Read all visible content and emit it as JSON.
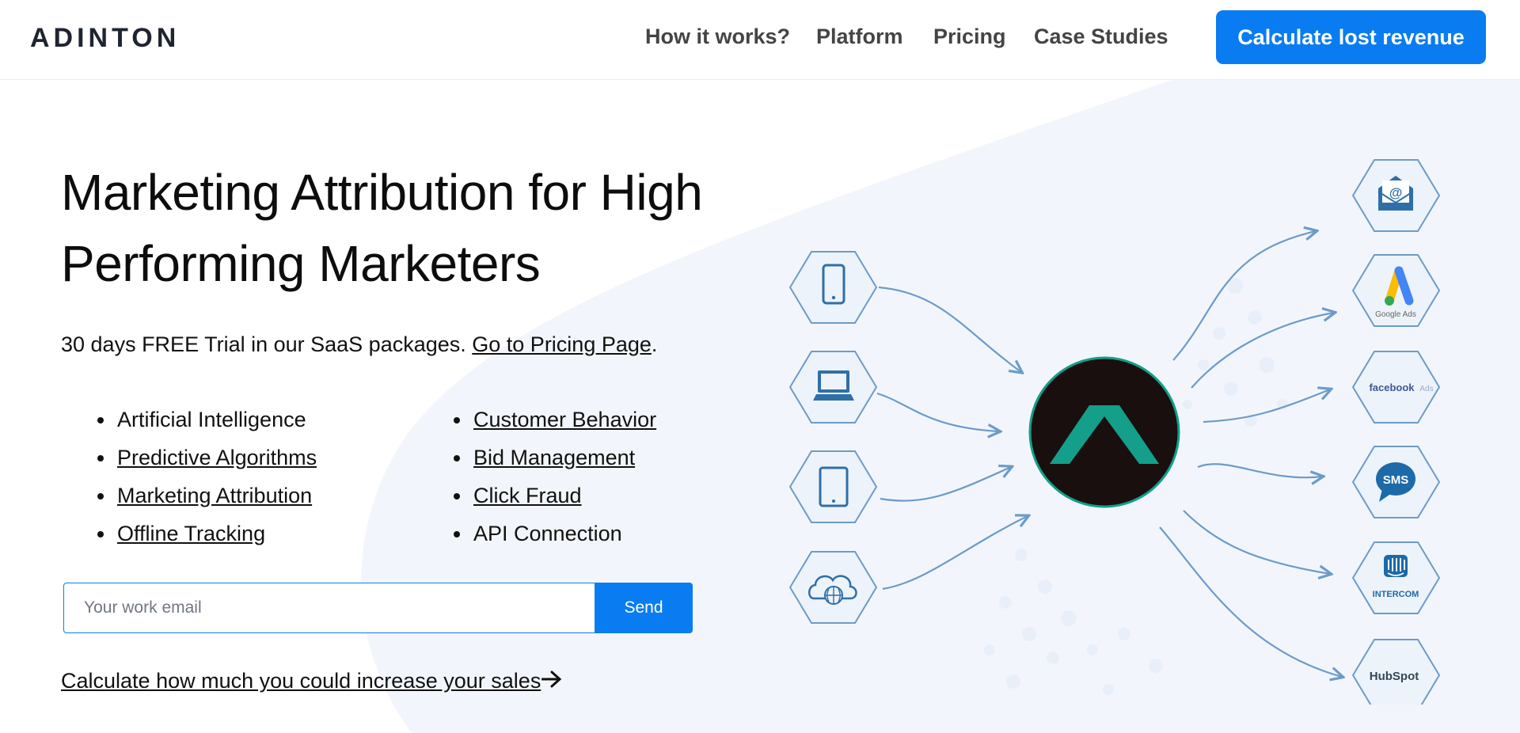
{
  "header": {
    "logo_text": "ADINTON",
    "nav": [
      {
        "label": "How it works?"
      },
      {
        "label": "Platform"
      },
      {
        "label": "Pricing"
      },
      {
        "label": "Case Studies"
      }
    ],
    "cta_label": "Calculate lost revenue"
  },
  "hero": {
    "title_line1": "Marketing Attribution for High",
    "title_line2": "Performing Marketers",
    "trial_text": "30 days FREE Trial in our SaaS packages. ",
    "trial_link": "Go to Pricing Page",
    "trial_suffix": ".",
    "features_left": [
      {
        "label": "Artificial Intelligence"
      },
      {
        "label": "Predictive Algorithms"
      },
      {
        "label": "Marketing Attribution"
      },
      {
        "label": "Offline Tracking"
      }
    ],
    "features_right": [
      {
        "label": "Customer Behavior"
      },
      {
        "label": "Bid Management"
      },
      {
        "label": "Click Fraud"
      },
      {
        "label": "API Connection"
      }
    ],
    "email_placeholder": "Your work email",
    "send_label": "Send",
    "calc_link": "Calculate how much you could increase your sales"
  },
  "illustration": {
    "sources": [
      "mobile-icon",
      "desktop-icon",
      "tablet-icon",
      "cloud-globe-icon"
    ],
    "hub_icon": "adinton-hub-icon",
    "channels": {
      "email_at": "@",
      "google_ads_label": "Google Ads",
      "facebook_label": "facebook",
      "facebook_suffix": "Ads",
      "sms_label": "SMS",
      "intercom_label": "INTERCOM",
      "hubspot_label": "HubSpot"
    }
  },
  "colors": {
    "accent": "#0a7cf2",
    "hexagon_stroke": "#6d9bc9",
    "hexagon_fill": "#edf3fa",
    "icon_blue": "#2f6fa8",
    "hub_bg": "#1a0f0f",
    "hub_mark": "#139f89",
    "bg_shape": "#f2f6fc"
  }
}
